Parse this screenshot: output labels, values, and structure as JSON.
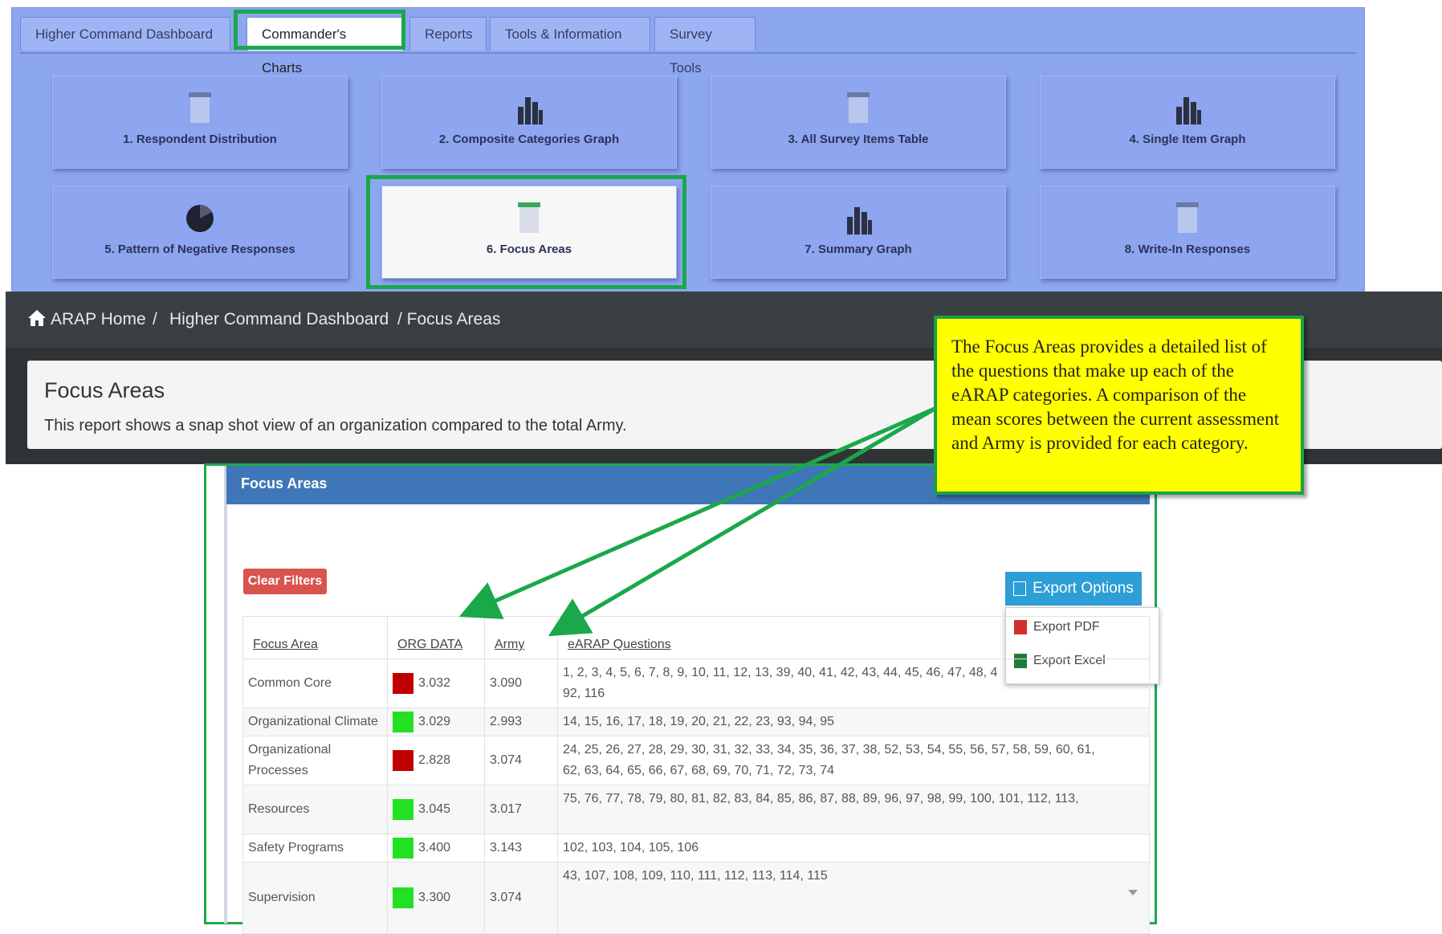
{
  "tabs": [
    "Higher Command Dashboard",
    "Commander's Charts",
    "Reports",
    "Tools & Information",
    "Survey Tools"
  ],
  "tiles": [
    {
      "label": "1. Respondent Distribution",
      "icon": "document-icon"
    },
    {
      "label": "2. Composite Categories Graph",
      "icon": "bar-chart-icon"
    },
    {
      "label": "3. All Survey Items Table",
      "icon": "document-icon"
    },
    {
      "label": "4. Single Item Graph",
      "icon": "bar-chart-icon"
    },
    {
      "label": "5. Pattern of Negative Responses",
      "icon": "pie-chart-icon"
    },
    {
      "label": "6. Focus Areas",
      "icon": "document-icon"
    },
    {
      "label": "7. Summary Graph",
      "icon": "bar-chart-icon"
    },
    {
      "label": "8. Write-In Responses",
      "icon": "document-icon"
    }
  ],
  "breadcrumb": {
    "home": "ARAP Home",
    "sep": "/",
    "level1": "Higher Command Dashboard",
    "level2": "/ Focus Areas"
  },
  "header": {
    "title": "Focus Areas",
    "subtitle": "This report shows a snap shot view of an organization compared to the total Army."
  },
  "panel": {
    "title": "Focus Areas",
    "clear_filters": "Clear Filters",
    "export": {
      "button": "Export Options",
      "pdf": "Export PDF",
      "excel": "Export Excel"
    },
    "columns": [
      "Focus Area",
      "ORG DATA",
      "Army",
      "eARAP Questions"
    ],
    "rows": [
      {
        "area": "Common Core",
        "status": "red",
        "org": "3.032",
        "army": "3.090",
        "questions": "1, 2, 3, 4, 5, 6, 7, 8, 9, 10, 11, 12, 13, 39, 40, 41, 42, 43, 44, 45, 46, 47, 48, 4",
        "questions2": "92, 116"
      },
      {
        "area": "Organizational Climate",
        "status": "green",
        "org": "3.029",
        "army": "2.993",
        "questions": "14, 15, 16, 17, 18, 19, 20, 21, 22, 23, 93, 94, 95",
        "questions2": ""
      },
      {
        "area": "Organizational Processes",
        "status": "red",
        "org": "2.828",
        "army": "3.074",
        "questions": "24, 25, 26, 27, 28, 29, 30, 31, 32, 33, 34, 35, 36, 37, 38, 52, 53, 54, 55, 56, 57, 58, 59, 60, 61,",
        "questions2": "62, 63, 64, 65, 66, 67, 68, 69, 70, 71, 72, 73, 74"
      },
      {
        "area": "Resources",
        "status": "green",
        "org": "3.045",
        "army": "3.017",
        "questions": "75, 76, 77, 78, 79, 80, 81, 82, 83, 84, 85, 86, 87, 88, 89, 96, 97, 98, 99, 100, 101, 112, 113,",
        "questions2": ""
      },
      {
        "area": "Safety Programs",
        "status": "green",
        "org": "3.400",
        "army": "3.143",
        "questions": "102, 103, 104, 105, 106",
        "questions2": ""
      },
      {
        "area": "Supervision",
        "status": "green",
        "org": "3.300",
        "army": "3.074",
        "questions": "43, 107, 108, 109, 110, 111, 112, 113, 114, 115",
        "questions2": ""
      }
    ]
  },
  "callout": "The Focus Areas provides a detailed list of the questions that make up each of the eARAP categories. A comparison of the mean scores between the current assessment and Army is provided for each category.",
  "colors": {
    "red": "#c00000",
    "green": "#22e022",
    "accent": "#1aa84a"
  }
}
